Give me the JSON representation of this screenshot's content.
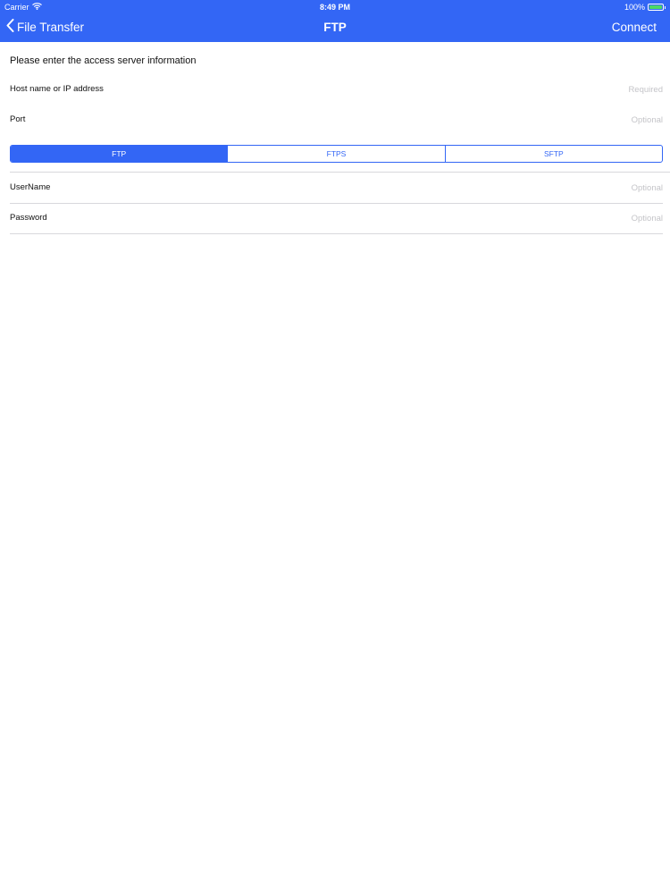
{
  "status_bar": {
    "carrier": "Carrier",
    "time": "8:49 PM",
    "battery": "100%"
  },
  "nav": {
    "back_label": "File Transfer",
    "title": "FTP",
    "connect_label": "Connect"
  },
  "form": {
    "intro": "Please enter the access server information",
    "host": {
      "label": "Host name or IP address",
      "placeholder": "Required",
      "value": ""
    },
    "port": {
      "label": "Port",
      "placeholder": "Optional",
      "value": ""
    },
    "protocols": [
      {
        "label": "FTP",
        "selected": true
      },
      {
        "label": "FTPS",
        "selected": false
      },
      {
        "label": "SFTP",
        "selected": false
      }
    ],
    "username": {
      "label": "UserName",
      "placeholder": "Optional",
      "value": ""
    },
    "password": {
      "label": "Password",
      "placeholder": "Optional",
      "value": ""
    }
  },
  "colors": {
    "accent": "#3366f5",
    "battery": "#4cd964",
    "placeholder": "#c4c4c8",
    "divider": "#d8d8dc"
  },
  "icons": {
    "wifi": "wifi-icon",
    "battery": "battery-icon",
    "back": "chevron-left-icon"
  }
}
